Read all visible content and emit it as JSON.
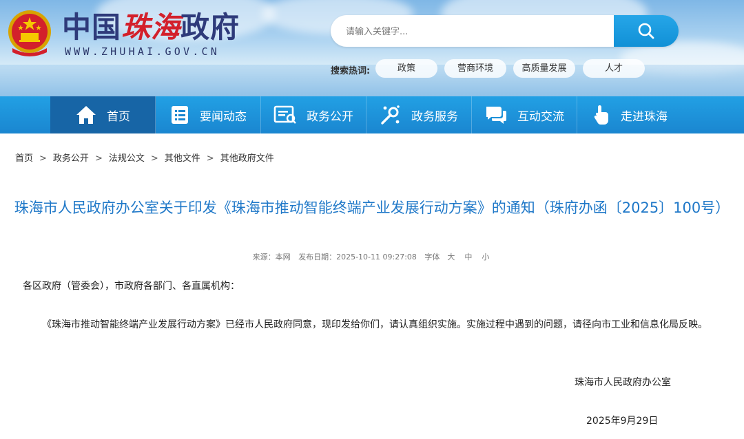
{
  "header": {
    "title_part1": "中国",
    "title_part2": "珠海",
    "title_part3": "政府",
    "domain": "WWW.ZHUHAI.GOV.CN",
    "emblem_icon": "national-emblem-icon"
  },
  "search": {
    "placeholder": "请输入关键字...",
    "button_icon": "search-icon",
    "hot_label": "搜索热词:",
    "hot_tags": [
      "政策",
      "营商环境",
      "高质量发展",
      "人才"
    ]
  },
  "nav": {
    "items": [
      {
        "label": "首页",
        "icon": "home-icon"
      },
      {
        "label": "要闻动态",
        "icon": "news-list-icon"
      },
      {
        "label": "政务公开",
        "icon": "document-icon"
      },
      {
        "label": "政务服务",
        "icon": "service-icon"
      },
      {
        "label": "互动交流",
        "icon": "chat-icon"
      },
      {
        "label": "走进珠海",
        "icon": "hand-pointer-icon"
      }
    ]
  },
  "breadcrumb": [
    "首页",
    "政务公开",
    "法规公文",
    "其他文件",
    "其他政府文件"
  ],
  "breadcrumb_sep": ">",
  "article": {
    "title": "珠海市人民政府办公室关于印发《珠海市推动智能终端产业发展行动方案》的通知（珠府办函〔2025〕100号）",
    "meta": {
      "source": "来源：本网",
      "date": "发布日期：2025-10-11 09:27:08",
      "font_label": "字体",
      "font_sizes": [
        "大",
        "中",
        "小"
      ]
    },
    "salutation": "各区政府（管委会），市政府各部门、各直属机构：",
    "body": "《珠海市推动智能终端产业发展行动方案》已经市人民政府同意，现印发给你们，请认真组织实施。实施过程中遇到的问题，请径向市工业和信息化局反映。",
    "signature": "珠海市人民政府办公室",
    "sign_date": "2025年9月29日"
  },
  "colors": {
    "nav_bg": "#1a86d0",
    "nav_active": "#1765a6",
    "title_blue": "#1f78c8",
    "brand_red": "#d3202b",
    "brand_navy": "#2e3a7a"
  }
}
